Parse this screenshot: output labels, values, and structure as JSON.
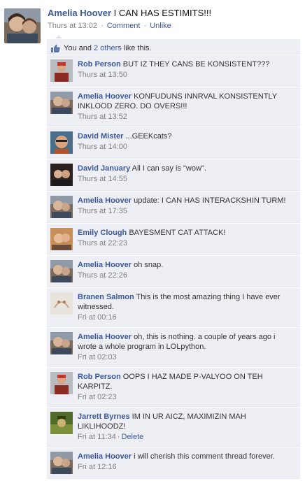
{
  "post": {
    "author": "Amelia Hoover",
    "text": "I CAN HAS ESTIMITS!!!",
    "time": "Thurs at 13:02",
    "comment_label": "Comment",
    "unlike_label": "Unlike"
  },
  "likes": {
    "prefix": "You and ",
    "others_link": "2 others",
    "suffix": " like this."
  },
  "comments": [
    {
      "author": "Rob Person",
      "text": "BUT IZ THEY CANS BE KONSISTENT???",
      "time": "Thurs at 13:50"
    },
    {
      "author": "Amelia Hoover",
      "text": "KONFUDUNS INNRVAL KONSISTENTLY INKLOOD ZERO. DO OVERS!!!",
      "time": "Thurs at 13:52"
    },
    {
      "author": "David Mister",
      "text": "...GEEKcats?",
      "time": "Thurs at 14:00"
    },
    {
      "author": "David January",
      "text": "All I can say is \"wow\".",
      "time": "Thurs at 14:55"
    },
    {
      "author": "Amelia Hoover",
      "text": "update: I CAN HAS INTERACKSHIN TURM!",
      "time": "Thurs at 17:35"
    },
    {
      "author": "Emily Clough",
      "text": "BAYESMENT CAT ATTACK!",
      "time": "Thurs at 22:23"
    },
    {
      "author": "Amelia Hoover",
      "text": "oh snap.",
      "time": "Thurs at 22:26"
    },
    {
      "author": "Branen Salmon",
      "text": "This is the most amazing thing I have ever witnessed.",
      "time": "Fri at 00:16"
    },
    {
      "author": "Amelia Hoover",
      "text": "oh, this is nothing. a couple of years ago i wrote a whole program in LOLpython.",
      "time": "Fri at 02:03"
    },
    {
      "author": "Rob Person",
      "text": "OOPS I HAZ MADE P-VALYOO ON TEH KARPITZ.",
      "time": "Fri at 02:23"
    },
    {
      "author": "Jarrett Byrnes",
      "text": "IM IN UR AICZ, MAXIMIZIN MAH LIKLIHOODZ!",
      "time": "Fri at 11:34",
      "delete_label": "Delete"
    },
    {
      "author": "Amelia Hoover",
      "text": "i will cherish this comment thread forever.",
      "time": "Fri at 12:16"
    }
  ]
}
